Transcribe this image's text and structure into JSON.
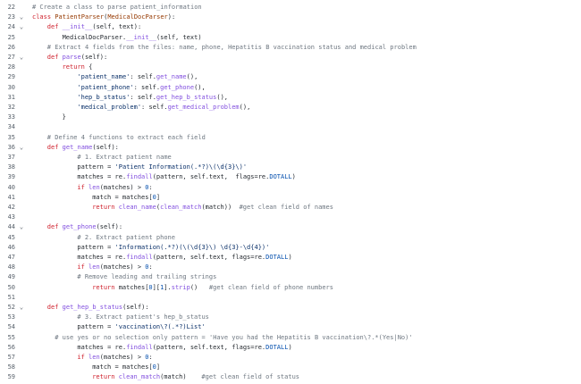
{
  "editor": {
    "fold_glyph": "⌄",
    "lines": [
      {
        "n": "22",
        "fold": false,
        "indent": 0,
        "segs": [
          [
            "cm",
            "# Create a class to parse patient_information"
          ]
        ]
      },
      {
        "n": "23",
        "fold": true,
        "indent": 0,
        "segs": [
          [
            "kw",
            "class "
          ],
          [
            "cls",
            "PatientParser"
          ],
          [
            "",
            "("
          ],
          [
            "cls",
            "MedicalDocParser"
          ],
          [
            "",
            "):"
          ]
        ]
      },
      {
        "n": "24",
        "fold": true,
        "indent": 4,
        "segs": [
          [
            "kw",
            "def "
          ],
          [
            "fn",
            "__init__"
          ],
          [
            "",
            "(self, text):"
          ]
        ]
      },
      {
        "n": "25",
        "fold": false,
        "indent": 8,
        "segs": [
          [
            "",
            "MedicalDocParser."
          ],
          [
            "fn",
            "__init__"
          ],
          [
            "",
            "(self, text)"
          ]
        ]
      },
      {
        "n": "26",
        "fold": false,
        "indent": 4,
        "segs": [
          [
            "cm",
            "# Extract 4 fields from the files: name, phone, Hepatitis B vaccination status and medical problem"
          ]
        ]
      },
      {
        "n": "27",
        "fold": true,
        "indent": 4,
        "segs": [
          [
            "kw",
            "def "
          ],
          [
            "fn",
            "parse"
          ],
          [
            "",
            "(self):"
          ]
        ]
      },
      {
        "n": "28",
        "fold": false,
        "indent": 8,
        "segs": [
          [
            "kw",
            "return "
          ],
          [
            "",
            "{"
          ]
        ]
      },
      {
        "n": "29",
        "fold": false,
        "indent": 12,
        "segs": [
          [
            "str",
            "'patient_name'"
          ],
          [
            "",
            ": self."
          ],
          [
            "fn",
            "get_name"
          ],
          [
            "",
            "(),"
          ]
        ]
      },
      {
        "n": "30",
        "fold": false,
        "indent": 12,
        "segs": [
          [
            "str",
            "'patient_phone'"
          ],
          [
            "",
            ": self."
          ],
          [
            "fn",
            "get_phone"
          ],
          [
            "",
            "(),"
          ]
        ]
      },
      {
        "n": "31",
        "fold": false,
        "indent": 12,
        "segs": [
          [
            "str",
            "'hep_b_status'"
          ],
          [
            "",
            ": self."
          ],
          [
            "fn",
            "get_hep_b_status"
          ],
          [
            "",
            "(),"
          ]
        ]
      },
      {
        "n": "32",
        "fold": false,
        "indent": 12,
        "segs": [
          [
            "str",
            "'medical_problem'"
          ],
          [
            "",
            ": self."
          ],
          [
            "fn",
            "get_medical_problem"
          ],
          [
            "",
            "(),"
          ]
        ]
      },
      {
        "n": "33",
        "fold": false,
        "indent": 8,
        "segs": [
          [
            "",
            "}"
          ]
        ]
      },
      {
        "n": "34",
        "fold": false,
        "indent": 0,
        "segs": []
      },
      {
        "n": "35",
        "fold": false,
        "indent": 4,
        "segs": [
          [
            "cm",
            "# Define 4 functions to extract each field"
          ]
        ]
      },
      {
        "n": "36",
        "fold": true,
        "indent": 4,
        "segs": [
          [
            "kw",
            "def "
          ],
          [
            "fn",
            "get_name"
          ],
          [
            "",
            "(self):"
          ]
        ]
      },
      {
        "n": "37",
        "fold": false,
        "indent": 12,
        "segs": [
          [
            "cm",
            "# 1. Extract patient name"
          ]
        ]
      },
      {
        "n": "38",
        "fold": false,
        "indent": 12,
        "segs": [
          [
            "",
            "pattern = "
          ],
          [
            "str",
            "'Patient Information(.*?)\\(\\d{3}\\)'"
          ]
        ]
      },
      {
        "n": "39",
        "fold": false,
        "indent": 12,
        "segs": [
          [
            "",
            "matches = re."
          ],
          [
            "fn",
            "findall"
          ],
          [
            "",
            "(pattern, self.text,  flags=re."
          ],
          [
            "num",
            "DOTALL"
          ],
          [
            "",
            ")"
          ]
        ]
      },
      {
        "n": "40",
        "fold": false,
        "indent": 12,
        "segs": [
          [
            "kw",
            "if "
          ],
          [
            "fn",
            "len"
          ],
          [
            "",
            "(matches) > "
          ],
          [
            "num",
            "0"
          ],
          [
            "",
            ":"
          ]
        ]
      },
      {
        "n": "41",
        "fold": false,
        "indent": 16,
        "segs": [
          [
            "",
            "match = matches["
          ],
          [
            "num",
            "0"
          ],
          [
            "",
            "]"
          ]
        ]
      },
      {
        "n": "42",
        "fold": false,
        "indent": 16,
        "segs": [
          [
            "kw",
            "return "
          ],
          [
            "fn",
            "clean_name"
          ],
          [
            "",
            "("
          ],
          [
            "fn",
            "clean_match"
          ],
          [
            "",
            "(match))  "
          ],
          [
            "cm",
            "#get clean field of names"
          ]
        ]
      },
      {
        "n": "43",
        "fold": false,
        "indent": 0,
        "segs": []
      },
      {
        "n": "44",
        "fold": true,
        "indent": 4,
        "segs": [
          [
            "kw",
            "def "
          ],
          [
            "fn",
            "get_phone"
          ],
          [
            "",
            "(self):"
          ]
        ]
      },
      {
        "n": "45",
        "fold": false,
        "indent": 12,
        "segs": [
          [
            "cm",
            "# 2. Extract patient phone"
          ]
        ]
      },
      {
        "n": "46",
        "fold": false,
        "indent": 12,
        "segs": [
          [
            "",
            "pattern = "
          ],
          [
            "str",
            "'Information(.*?)(\\(\\d{3}\\) \\d{3}-\\d{4})'"
          ]
        ]
      },
      {
        "n": "47",
        "fold": false,
        "indent": 12,
        "segs": [
          [
            "",
            "matches = re."
          ],
          [
            "fn",
            "findall"
          ],
          [
            "",
            "(pattern, self.text, flags=re."
          ],
          [
            "num",
            "DOTALL"
          ],
          [
            "",
            ")"
          ]
        ]
      },
      {
        "n": "48",
        "fold": false,
        "indent": 12,
        "segs": [
          [
            "kw",
            "if "
          ],
          [
            "fn",
            "len"
          ],
          [
            "",
            "(matches) > "
          ],
          [
            "num",
            "0"
          ],
          [
            "",
            ":"
          ]
        ]
      },
      {
        "n": "49",
        "fold": false,
        "indent": 12,
        "segs": [
          [
            "cm",
            "# Remove leading and trailing strings"
          ]
        ]
      },
      {
        "n": "50",
        "fold": false,
        "indent": 16,
        "segs": [
          [
            "kw",
            "return "
          ],
          [
            "",
            "matches["
          ],
          [
            "num",
            "0"
          ],
          [
            "",
            "]["
          ],
          [
            "num",
            "1"
          ],
          [
            "",
            "]."
          ],
          [
            "fn",
            "strip"
          ],
          [
            "",
            "()   "
          ],
          [
            "cm",
            "#get clean field of phone numbers"
          ]
        ]
      },
      {
        "n": "51",
        "fold": false,
        "indent": 0,
        "segs": []
      },
      {
        "n": "52",
        "fold": true,
        "indent": 4,
        "segs": [
          [
            "kw",
            "def "
          ],
          [
            "fn",
            "get_hep_b_status"
          ],
          [
            "",
            "(self):"
          ]
        ]
      },
      {
        "n": "53",
        "fold": false,
        "indent": 12,
        "segs": [
          [
            "cm",
            "# 3. Extract patient's hep_b_status"
          ]
        ]
      },
      {
        "n": "54",
        "fold": false,
        "indent": 12,
        "segs": [
          [
            "",
            "pattern = "
          ],
          [
            "str",
            "'vaccination\\?(.*?)List'"
          ]
        ]
      },
      {
        "n": "55",
        "fold": false,
        "indent": 6,
        "segs": [
          [
            "cm",
            "# use yes or no selection only pattern = 'Have you had the Hepatitis B vaccination\\?.*(Yes|No)'"
          ]
        ]
      },
      {
        "n": "56",
        "fold": false,
        "indent": 12,
        "segs": [
          [
            "",
            "matches = re."
          ],
          [
            "fn",
            "findall"
          ],
          [
            "",
            "(pattern, self.text, flags=re."
          ],
          [
            "num",
            "DOTALL"
          ],
          [
            "",
            ")"
          ]
        ]
      },
      {
        "n": "57",
        "fold": false,
        "indent": 12,
        "segs": [
          [
            "kw",
            "if "
          ],
          [
            "fn",
            "len"
          ],
          [
            "",
            "(matches) > "
          ],
          [
            "num",
            "0"
          ],
          [
            "",
            ":"
          ]
        ]
      },
      {
        "n": "58",
        "fold": false,
        "indent": 16,
        "segs": [
          [
            "",
            "match = matches["
          ],
          [
            "num",
            "0"
          ],
          [
            "",
            "]"
          ]
        ]
      },
      {
        "n": "59",
        "fold": false,
        "indent": 16,
        "segs": [
          [
            "kw",
            "return "
          ],
          [
            "fn",
            "clean_match"
          ],
          [
            "",
            "(match)    "
          ],
          [
            "cm",
            "#get clean field of status"
          ]
        ]
      }
    ]
  }
}
